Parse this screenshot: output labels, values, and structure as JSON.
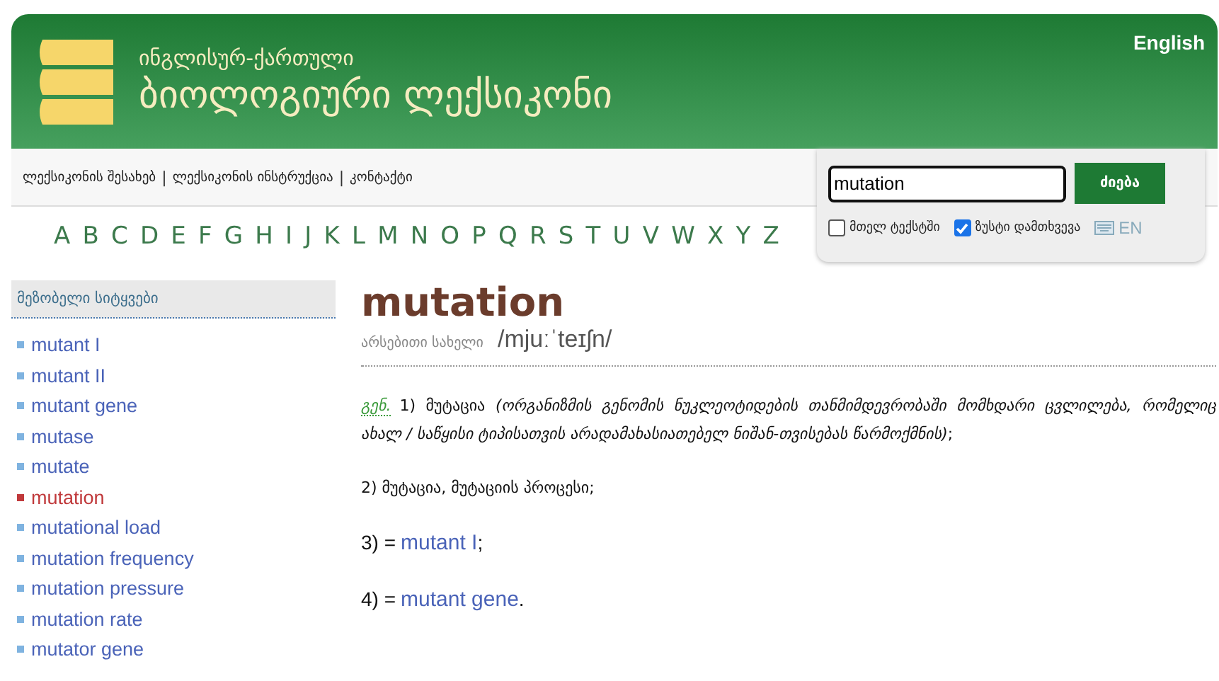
{
  "header": {
    "subtitle": "ინგლისურ-ქართული",
    "title": "ბიოლოგიური ლექსიკონი",
    "language_link": "English"
  },
  "nav_links": [
    "ლექსიკონის შესახებ",
    "ლექსიკონის ინსტრუქცია",
    "კონტაქტი"
  ],
  "nav_separator": "|",
  "search": {
    "value": "mutation",
    "button": "ძიება",
    "options": [
      {
        "label": "მთელ ტექსტში",
        "checked": false
      },
      {
        "label": "ზუსტი დამთხვევა",
        "checked": true
      }
    ],
    "keyboard": "EN"
  },
  "alphabet": [
    "A",
    "B",
    "C",
    "D",
    "E",
    "F",
    "G",
    "H",
    "I",
    "J",
    "K",
    "L",
    "M",
    "N",
    "O",
    "P",
    "Q",
    "R",
    "S",
    "T",
    "U",
    "V",
    "W",
    "X",
    "Y",
    "Z"
  ],
  "sidebar": {
    "title": "მეზობელი სიტყვები",
    "items": [
      {
        "label": "mutant I",
        "selected": false
      },
      {
        "label": "mutant II",
        "selected": false
      },
      {
        "label": "mutant gene",
        "selected": false
      },
      {
        "label": "mutase",
        "selected": false
      },
      {
        "label": "mutate",
        "selected": false
      },
      {
        "label": "mutation",
        "selected": true
      },
      {
        "label": "mutational load",
        "selected": false
      },
      {
        "label": "mutation frequency",
        "selected": false
      },
      {
        "label": "mutation pressure",
        "selected": false
      },
      {
        "label": "mutation rate",
        "selected": false
      },
      {
        "label": "mutator gene",
        "selected": false
      }
    ]
  },
  "entry": {
    "word": "mutation",
    "part_of_speech": "არსებითი სახელი",
    "pronunciation": "/mjuːˈteɪʃn/",
    "senses": [
      {
        "label": "გენ.",
        "text": "1) მუტაცია *(ორგანიზმის გენომის ნუკლეოტიდების თანმიმდევრობაში მომხდარი ცვლილება, რომელიც ახალ / საწყისი ტიპისათვის არადამახასიათებელ ნიშან-თვისებას წარმოქმნის)*;"
      },
      {
        "text": "2) მუტაცია, მუტაციის პროცესი;"
      },
      {
        "text": "3) =",
        "link": "mutant I",
        "suffix": ";"
      },
      {
        "text": "4) =",
        "link": "mutant gene",
        "suffix": "."
      }
    ]
  }
}
